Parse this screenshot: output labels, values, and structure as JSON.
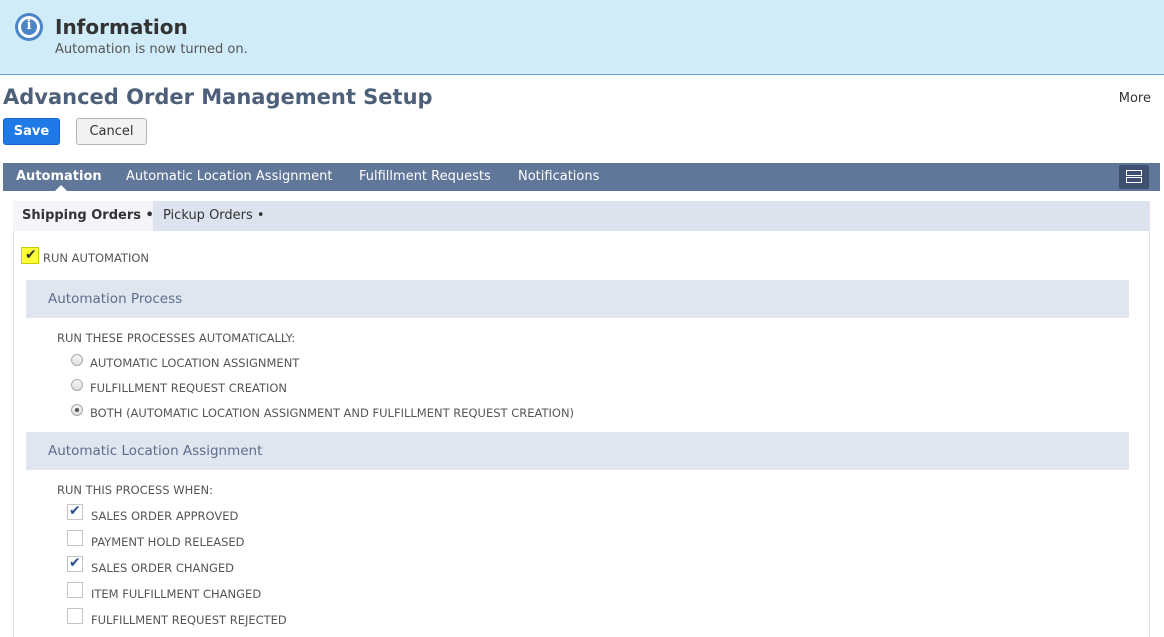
{
  "banner": {
    "icon": "info-icon",
    "icon_glyph": "i",
    "title": "Information",
    "message": "Automation is now turned on."
  },
  "header": {
    "title": "Advanced Order Management Setup",
    "more_label": "More",
    "save_label": "Save",
    "cancel_label": "Cancel"
  },
  "tabs": [
    {
      "label": "Automation",
      "active": true
    },
    {
      "label": "Automatic Location Assignment",
      "active": false
    },
    {
      "label": "Fulfillment Requests",
      "active": false
    },
    {
      "label": "Notifications",
      "active": false
    }
  ],
  "subtabs": [
    {
      "label": "Shipping Orders",
      "active": true
    },
    {
      "label": "Pickup Orders",
      "active": false
    }
  ],
  "subtab_dot": "•",
  "run_automation": {
    "label": "RUN AUTOMATION",
    "checked": true
  },
  "automation_process": {
    "title": "Automation Process",
    "prompt": "RUN THESE PROCESSES AUTOMATICALLY:",
    "options": [
      {
        "label": "AUTOMATIC LOCATION ASSIGNMENT",
        "selected": false
      },
      {
        "label": "FULFILLMENT REQUEST CREATION",
        "selected": false
      },
      {
        "label": "BOTH (AUTOMATIC LOCATION ASSIGNMENT AND FULFILLMENT REQUEST CREATION)",
        "selected": true
      }
    ]
  },
  "location_assignment": {
    "title": "Automatic Location Assignment",
    "prompt": "RUN THIS PROCESS WHEN:",
    "options": [
      {
        "label": "SALES ORDER APPROVED",
        "checked": true
      },
      {
        "label": "PAYMENT HOLD RELEASED",
        "checked": false
      },
      {
        "label": "SALES ORDER CHANGED",
        "checked": true
      },
      {
        "label": "ITEM FULFILLMENT CHANGED",
        "checked": false
      },
      {
        "label": "FULFILLMENT REQUEST REJECTED",
        "checked": false
      }
    ]
  },
  "checkmark_glyph": "✔"
}
